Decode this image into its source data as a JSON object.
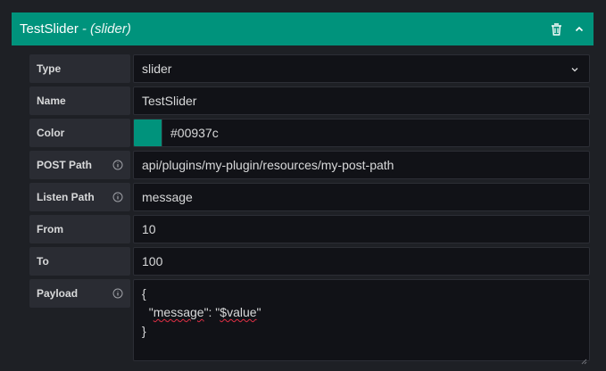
{
  "header": {
    "title": "TestSlider",
    "subtitle": "- (slider)",
    "accent_color": "#00937c",
    "icons": [
      "trash-icon",
      "chevron-up-icon"
    ]
  },
  "form": {
    "type": {
      "label": "Type",
      "value": "slider"
    },
    "name": {
      "label": "Name",
      "value": "TestSlider"
    },
    "color": {
      "label": "Color",
      "value": "#00937c",
      "swatch": "#00937c"
    },
    "post_path": {
      "label": "POST Path",
      "value": "api/plugins/my-plugin/resources/my-post-path"
    },
    "listen_path": {
      "label": "Listen Path",
      "value": "message"
    },
    "from": {
      "label": "From",
      "value": "10"
    },
    "to": {
      "label": "To",
      "value": "100"
    },
    "payload": {
      "label": "Payload",
      "line1": "{",
      "line2_indent": "  \"",
      "line2_key": "message",
      "line2_mid": "\": \"",
      "line2_val": "$value",
      "line2_end": "\"",
      "line3": "}"
    }
  }
}
